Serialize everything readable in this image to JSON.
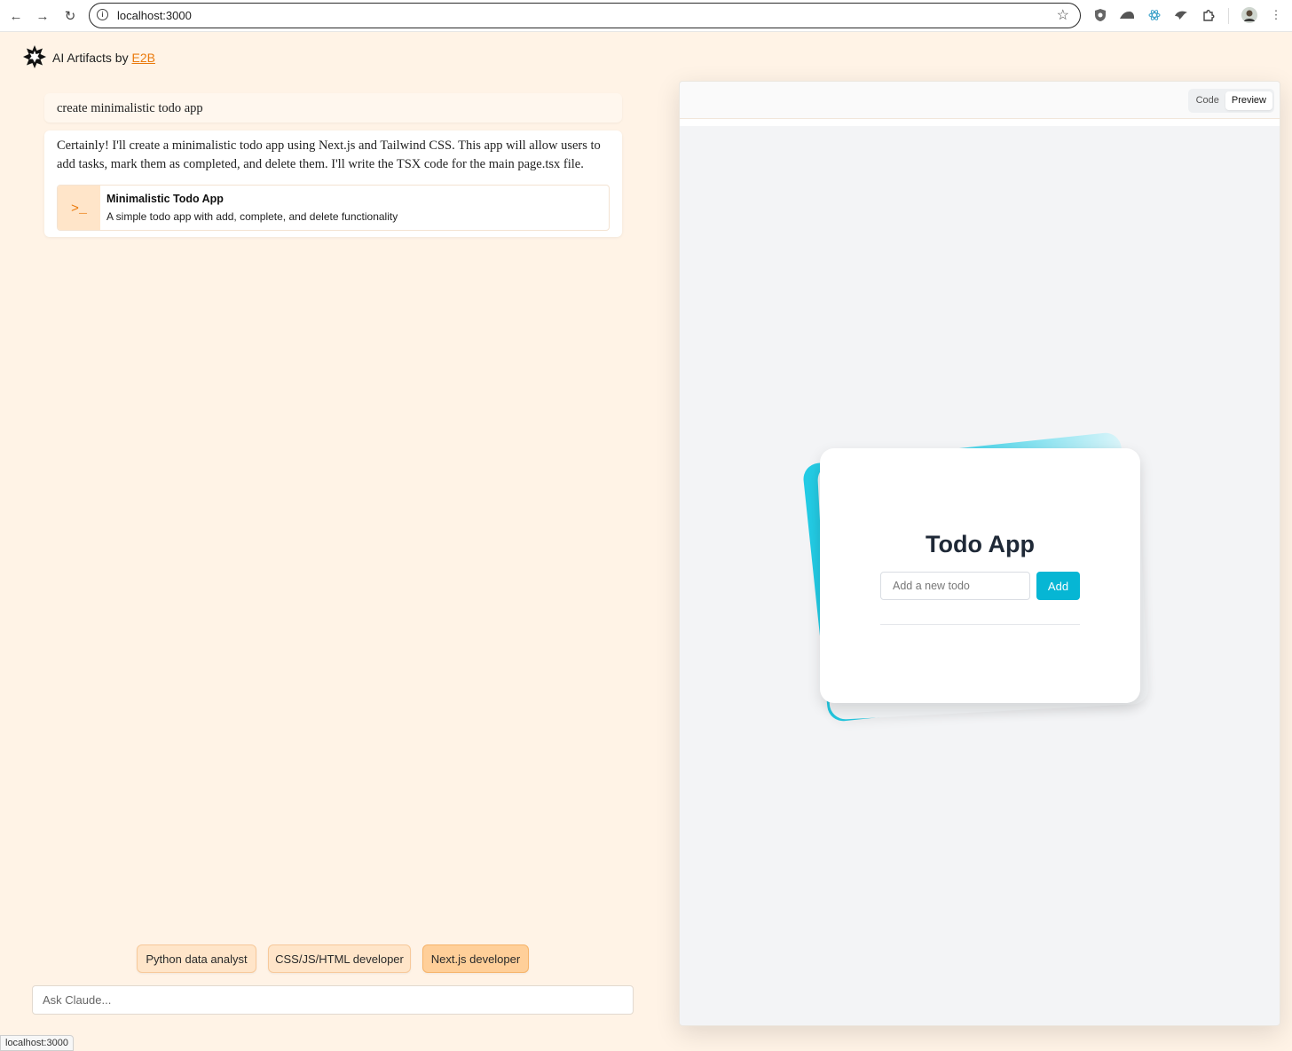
{
  "browser": {
    "url": "localhost:3000"
  },
  "app": {
    "brand_prefix": "AI Artifacts by ",
    "brand_link": "E2B"
  },
  "chat": {
    "user_message": "create minimalistic todo app",
    "assistant_message": "Certainly! I'll create a minimalistic todo app using Next.js and Tailwind CSS. This app will allow users to add tasks, mark them as completed, and delete them. I'll write the TSX code for the main page.tsx file.",
    "artifact": {
      "icon": ">_",
      "title": "Minimalistic Todo App",
      "description": "A simple todo app with add, complete, and delete functionality"
    },
    "templates": [
      {
        "label": "Python data analyst",
        "active": false
      },
      {
        "label": "CSS/JS/HTML developer",
        "active": false
      },
      {
        "label": "Next.js developer",
        "active": true
      }
    ],
    "input_placeholder": "Ask Claude..."
  },
  "preview": {
    "tabs": [
      {
        "label": "Code",
        "active": false
      },
      {
        "label": "Preview",
        "active": true
      }
    ],
    "todo": {
      "title": "Todo App",
      "input_placeholder": "Add a new todo",
      "add_label": "Add"
    }
  },
  "status_bar": {
    "text": "localhost:3000"
  },
  "colors": {
    "page_bg": "#fff3e6",
    "accent": "#ea7a0c",
    "todo_button": "#06b6d4"
  }
}
